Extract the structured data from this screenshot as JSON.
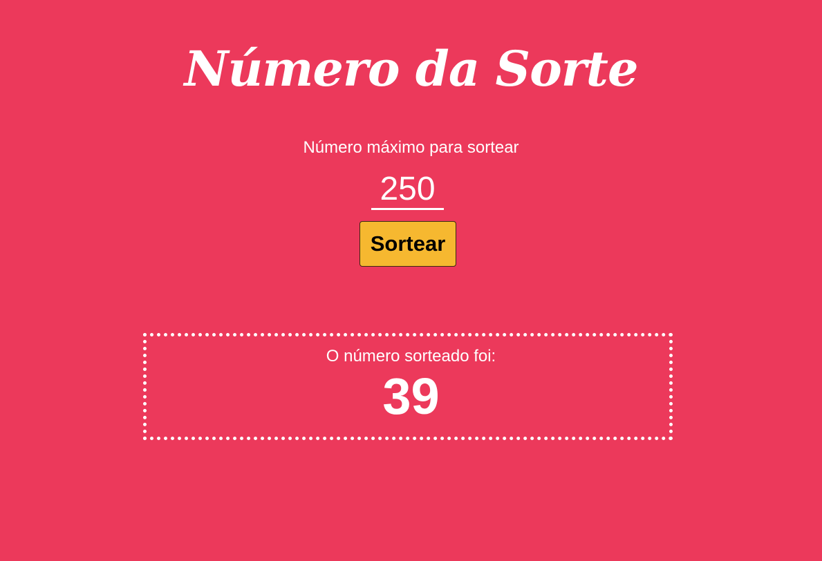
{
  "app": {
    "title": "Número da Sorte"
  },
  "form": {
    "max_label": "Número máximo para sortear",
    "max_value": "250",
    "draw_button_label": "Sortear"
  },
  "result": {
    "label": "O número sorteado foi:",
    "value": "39"
  },
  "colors": {
    "background": "#EC395B",
    "button": "#F6B830",
    "text": "#FFFFFF"
  }
}
